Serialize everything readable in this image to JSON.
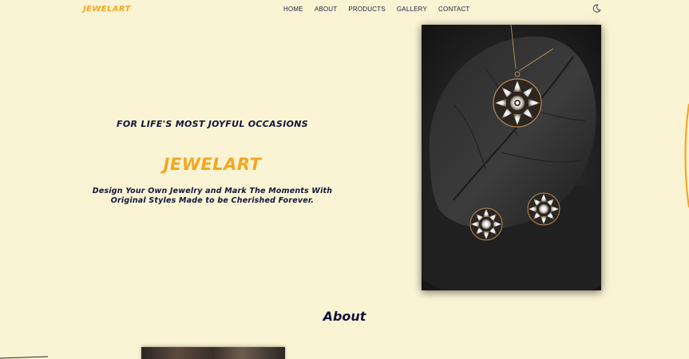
{
  "nav": {
    "logo": "JEWELART",
    "items": [
      "HOME",
      "ABOUT",
      "PRODUCTS",
      "GALLERY",
      "CONTACT"
    ],
    "theme_toggle_icon": "moon-icon"
  },
  "hero": {
    "tagline": "FOR LIFE'S MOST JOYFUL OCCASIONS",
    "brand": "JEWELART",
    "description": "Design Your Own Jewelry and Mark The Moments With Original Styles Made to be Cherished Forever.",
    "image": "pendant-and-earrings-on-black-leaf-plate"
  },
  "about": {
    "title": "About"
  },
  "colors": {
    "background": "#fbf4d4",
    "accent": "#f5a623",
    "text_dark": "#10143a"
  }
}
